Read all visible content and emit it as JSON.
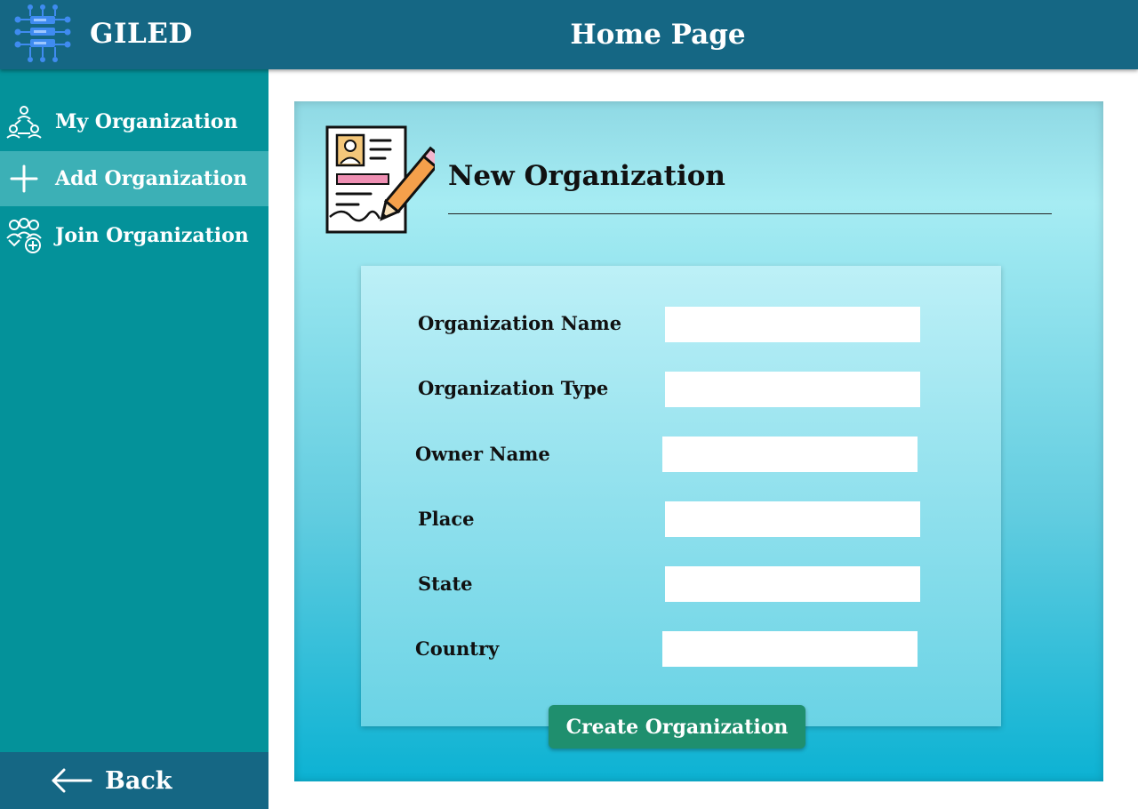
{
  "header": {
    "brand": "GILED",
    "title": "Home Page",
    "logo_icon": "database-network-icon",
    "color": "#156784"
  },
  "sidebar": {
    "items": [
      {
        "label": "My Organization",
        "icon": "network-people-icon",
        "active": false
      },
      {
        "label": "Add Organization",
        "icon": "plus-icon",
        "active": true
      },
      {
        "label": "Join Organization",
        "icon": "group-add-icon",
        "active": false
      }
    ],
    "back_label": "Back",
    "back_icon": "arrow-left-icon",
    "color": "#04929a",
    "active_color": "#3cb0b6"
  },
  "form": {
    "title": "New Organization",
    "icon": "document-signing-icon",
    "fields": [
      {
        "label": "Organization Name",
        "value": ""
      },
      {
        "label": "Organization Type",
        "value": ""
      },
      {
        "label": "Owner Name",
        "value": ""
      },
      {
        "label": "Place",
        "value": ""
      },
      {
        "label": "State",
        "value": ""
      },
      {
        "label": "Country",
        "value": ""
      }
    ],
    "submit_label": "Create Organization",
    "submit_color": "#1f8f6e"
  }
}
